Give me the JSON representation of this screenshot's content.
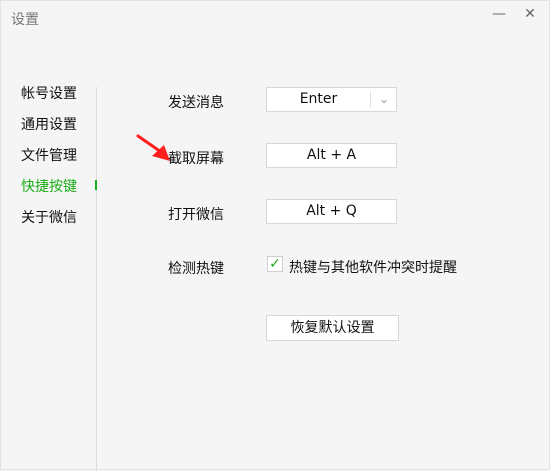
{
  "window": {
    "title": "设置"
  },
  "sidebar": {
    "items": [
      {
        "label": "帐号设置"
      },
      {
        "label": "通用设置"
      },
      {
        "label": "文件管理"
      },
      {
        "label": "快捷按键",
        "active": true
      },
      {
        "label": "关于微信"
      }
    ]
  },
  "shortcuts": {
    "send_message": {
      "label": "发送消息",
      "value": "Enter"
    },
    "capture_screen": {
      "label": "截取屏幕",
      "value": "Alt + A"
    },
    "open_wechat": {
      "label": "打开微信",
      "value": "Alt + Q"
    },
    "detect_hotkeys": {
      "label": "检测热键",
      "checkbox_label": "热键与其他软件冲突时提醒",
      "checked": true
    }
  },
  "buttons": {
    "restore_defaults": "恢复默认设置"
  },
  "colors": {
    "accent": "#1aad19",
    "annotation": "#ff1e1e",
    "background": "#f5f5f5"
  },
  "icons": {
    "minimize": "minimize-icon",
    "close": "close-icon",
    "dropdown": "chevron-down-icon",
    "check": "check-icon",
    "annotation_arrow": "red-arrow-icon"
  }
}
